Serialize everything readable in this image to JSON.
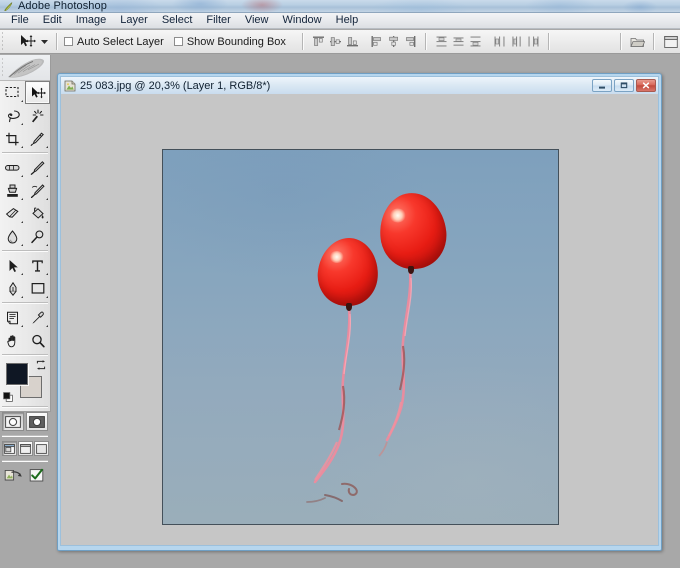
{
  "app": {
    "title": "Adobe Photoshop",
    "icon": "photoshop-feather-icon"
  },
  "menubar": {
    "items": [
      {
        "label": "File"
      },
      {
        "label": "Edit"
      },
      {
        "label": "Image"
      },
      {
        "label": "Layer"
      },
      {
        "label": "Select"
      },
      {
        "label": "Filter"
      },
      {
        "label": "View"
      },
      {
        "label": "Window"
      },
      {
        "label": "Help"
      }
    ]
  },
  "options_bar": {
    "active_tool_icon": "move-tool-icon",
    "preset_caret_icon": "chevron-down-icon",
    "checkboxes": [
      {
        "label": "Auto Select Layer",
        "checked": false
      },
      {
        "label": "Show Bounding Box",
        "checked": false
      }
    ],
    "align_buttons": [
      {
        "icon": "align-top-edges-icon"
      },
      {
        "icon": "align-vertical-centers-icon"
      },
      {
        "icon": "align-bottom-edges-icon"
      },
      {
        "icon": "align-left-edges-icon"
      },
      {
        "icon": "align-horizontal-centers-icon"
      },
      {
        "icon": "align-right-edges-icon"
      }
    ],
    "distribute_buttons": [
      {
        "icon": "distribute-top-edges-icon"
      },
      {
        "icon": "distribute-vertical-centers-icon"
      },
      {
        "icon": "distribute-bottom-edges-icon"
      },
      {
        "icon": "distribute-left-edges-icon"
      },
      {
        "icon": "distribute-horizontal-centers-icon"
      },
      {
        "icon": "distribute-right-edges-icon"
      }
    ],
    "right_buttons": [
      {
        "icon": "file-browser-icon"
      },
      {
        "icon": "palette-well-icon"
      }
    ]
  },
  "toolbox": {
    "tools": [
      {
        "name": "marquee-tool",
        "icon": "rectangular-marquee-icon",
        "active": false,
        "has_flyout": true
      },
      {
        "name": "move-tool",
        "icon": "move-tool-icon",
        "active": true,
        "has_flyout": false
      },
      {
        "name": "lasso-tool",
        "icon": "lasso-icon",
        "active": false,
        "has_flyout": true
      },
      {
        "name": "magic-wand-tool",
        "icon": "magic-wand-icon",
        "active": false,
        "has_flyout": false
      },
      {
        "name": "crop-tool",
        "icon": "crop-icon",
        "active": false,
        "has_flyout": false
      },
      {
        "name": "slice-tool",
        "icon": "slice-knife-icon",
        "active": false,
        "has_flyout": true
      },
      {
        "name": "healing-brush-tool",
        "icon": "healing-brush-icon",
        "active": false,
        "has_flyout": true
      },
      {
        "name": "brush-tool",
        "icon": "paintbrush-icon",
        "active": false,
        "has_flyout": true
      },
      {
        "name": "clone-stamp-tool",
        "icon": "clone-stamp-icon",
        "active": false,
        "has_flyout": true
      },
      {
        "name": "history-brush-tool",
        "icon": "history-brush-icon",
        "active": false,
        "has_flyout": true
      },
      {
        "name": "eraser-tool",
        "icon": "eraser-icon",
        "active": false,
        "has_flyout": true
      },
      {
        "name": "gradient-tool",
        "icon": "paint-bucket-icon",
        "active": false,
        "has_flyout": true
      },
      {
        "name": "blur-tool",
        "icon": "blur-droplet-icon",
        "active": false,
        "has_flyout": true
      },
      {
        "name": "dodge-tool",
        "icon": "dodge-burn-icon",
        "active": false,
        "has_flyout": true
      },
      {
        "name": "path-selection-tool",
        "icon": "path-selection-arrow-icon",
        "active": false,
        "has_flyout": true
      },
      {
        "name": "type-tool",
        "icon": "type-t-icon",
        "active": false,
        "has_flyout": true
      },
      {
        "name": "pen-tool",
        "icon": "pen-nib-icon",
        "active": false,
        "has_flyout": true
      },
      {
        "name": "shape-tool",
        "icon": "rectangle-shape-icon",
        "active": false,
        "has_flyout": true
      },
      {
        "name": "notes-tool",
        "icon": "notes-annotation-icon",
        "active": false,
        "has_flyout": true
      },
      {
        "name": "eyedropper-tool",
        "icon": "eyedropper-icon",
        "active": false,
        "has_flyout": true
      },
      {
        "name": "hand-tool",
        "icon": "hand-icon",
        "active": false,
        "has_flyout": false
      },
      {
        "name": "zoom-tool",
        "icon": "magnifier-icon",
        "active": false,
        "has_flyout": false
      }
    ],
    "colors": {
      "foreground": "#0f1724",
      "background": "#d8d2cc",
      "swap_icon": "swap-colors-icon",
      "default_icon": "default-colors-icon"
    },
    "quick_mask": [
      {
        "name": "standard-mode",
        "icon": "standard-mode-icon",
        "pressed": true
      },
      {
        "name": "quick-mask-mode",
        "icon": "quick-mask-mode-icon",
        "pressed": false
      }
    ],
    "screen_modes": [
      {
        "name": "standard-screen-mode",
        "icon": "standard-screen-icon",
        "pressed": true
      },
      {
        "name": "full-screen-with-menu-mode",
        "icon": "full-screen-menu-icon",
        "pressed": false
      },
      {
        "name": "full-screen-mode",
        "icon": "full-screen-icon",
        "pressed": false
      }
    ],
    "jump_buttons": [
      {
        "name": "jump-to-imageready",
        "icon": "jump-to-imageready-icon"
      },
      {
        "name": "imageready-check",
        "icon": "imageready-check-icon"
      }
    ]
  },
  "document": {
    "icon": "document-thumbnail-icon",
    "title": "25 083.jpg @ 20,3% (Layer 1, RGB/8*)",
    "filename": "25 083.jpg",
    "zoom": "20,3%",
    "layer": "Layer 1",
    "color_mode": "RGB/8*",
    "window_buttons": [
      {
        "name": "minimize-button",
        "icon": "minimize-icon"
      },
      {
        "name": "maximize-button",
        "icon": "maximize-icon"
      },
      {
        "name": "close-button",
        "icon": "close-x-icon"
      }
    ],
    "canvas": {
      "background_color": "#c6c6c6",
      "image_border_color": "#44505a"
    },
    "image_content": {
      "description": "Two red balloons floating against a blue-gray sky with long pink ribbon strings",
      "sky_top_color": "#7ea0bd",
      "sky_bottom_color": "#9aaeba",
      "balloon_color": "#e81d14",
      "ribbon_color": "#e8768a",
      "balloons": [
        {
          "name": "upper-right-balloon",
          "highlight": true
        },
        {
          "name": "lower-left-balloon",
          "highlight": true
        }
      ]
    }
  }
}
